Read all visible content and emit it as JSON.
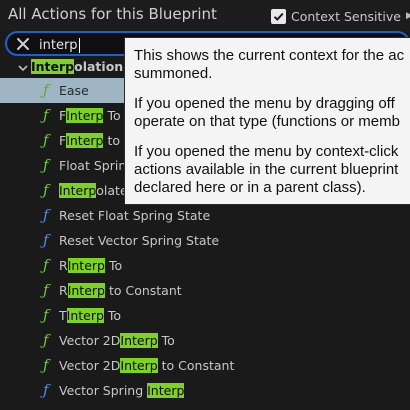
{
  "header": {
    "title": "All Actions for this Blueprint",
    "context_label": "Context Sensitive",
    "context_checked": true
  },
  "search": {
    "value": "interp"
  },
  "category": {
    "match": "Interp",
    "rest": "olation"
  },
  "rows": [
    {
      "pre": "",
      "match": "",
      "post": "Ease",
      "icon_color": "green",
      "selected": true
    },
    {
      "pre": "F",
      "match": "Interp",
      "post": " To",
      "icon_color": "green"
    },
    {
      "pre": "F",
      "match": "Interp",
      "post": " to C",
      "icon_color": "green"
    },
    {
      "pre": "Float Spring",
      "match": "",
      "post": "",
      "icon_color": "green"
    },
    {
      "pre": "",
      "match": "Interp",
      "post": "olate",
      "icon_color": "green"
    },
    {
      "pre": "Reset Float Spring State",
      "match": "",
      "post": "",
      "icon_color": "blue"
    },
    {
      "pre": "Reset Vector Spring State",
      "match": "",
      "post": "",
      "icon_color": "blue"
    },
    {
      "pre": "R",
      "match": "Interp",
      "post": " To",
      "icon_color": "green"
    },
    {
      "pre": "R",
      "match": "Interp",
      "post": " to Constant",
      "icon_color": "green"
    },
    {
      "pre": "T",
      "match": "Interp",
      "post": " To",
      "icon_color": "green"
    },
    {
      "pre": "Vector 2D",
      "match": "Interp",
      "post": " To",
      "icon_color": "green"
    },
    {
      "pre": "Vector 2D",
      "match": "Interp",
      "post": " to Constant",
      "icon_color": "green"
    },
    {
      "pre": "Vector Spring ",
      "match": "Interp",
      "post": "",
      "icon_color": "blue"
    }
  ],
  "tooltip": {
    "p1": "This shows the current context for the ac\nsummoned.",
    "p2": "If you opened the menu by dragging off\noperate on that type (functions or memb",
    "p3": "If you opened the menu by context-click\nactions available in the current blueprint\ndeclared here or in a parent class)."
  },
  "colors": {
    "accent": "#1b62d1",
    "highlight": "#7ed321",
    "selected_row": "#9fb5c4",
    "function_green": "#6acb3c",
    "function_blue": "#4d8cf0"
  },
  "icons": {
    "function": "ƒ"
  }
}
